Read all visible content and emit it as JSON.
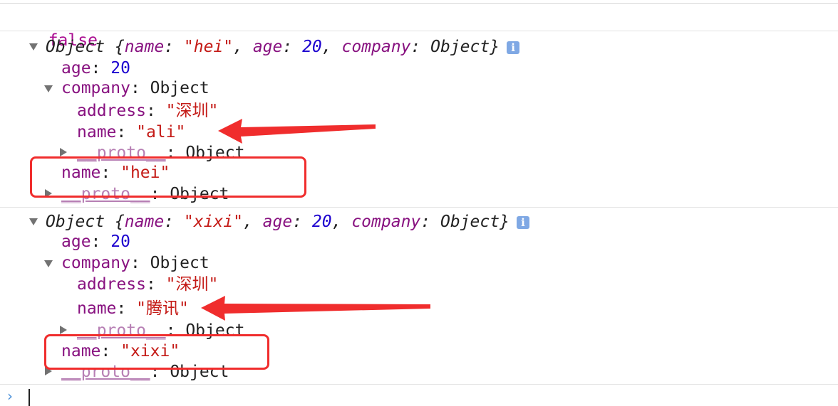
{
  "console": {
    "false_value": "false",
    "obj1": {
      "summary_prefix": "Object {",
      "name_key": "name",
      "name_val": "\"hei\"",
      "age_key": "age",
      "age_val": "20",
      "company_key": "company",
      "company_val": "Object",
      "suffix": "}",
      "age_line_key": "age",
      "age_line_val": "20",
      "company_line_key": "company",
      "company_line_val": "Object",
      "address_key": "address",
      "address_val": "\"深圳\"",
      "cname_key": "name",
      "cname_val": "\"ali\"",
      "cproto_key": "__proto__",
      "cproto_val": "Object",
      "name_line_key": "name",
      "name_line_val": "\"hei\"",
      "proto_key": "__proto__",
      "proto_val": "Object"
    },
    "obj2": {
      "summary_prefix": "Object {",
      "name_key": "name",
      "name_val": "\"xixi\"",
      "age_key": "age",
      "age_val": "20",
      "company_key": "company",
      "company_val": "Object",
      "suffix": "}",
      "age_line_key": "age",
      "age_line_val": "20",
      "company_line_key": "company",
      "company_line_val": "Object",
      "address_key": "address",
      "address_val": "\"深圳\"",
      "cname_key": "name",
      "cname_val": "\"腾讯\"",
      "cproto_key": "__proto__",
      "cproto_val": "Object",
      "name_line_key": "name",
      "name_line_val": "\"xixi\"",
      "proto_key": "__proto__",
      "proto_val": "Object"
    },
    "info_glyph": "i",
    "prompt_glyph": "›",
    "colors": {
      "key": "#881280",
      "string": "#c41a16",
      "number": "#1c00cf",
      "annotation": "#f02d2d"
    }
  }
}
